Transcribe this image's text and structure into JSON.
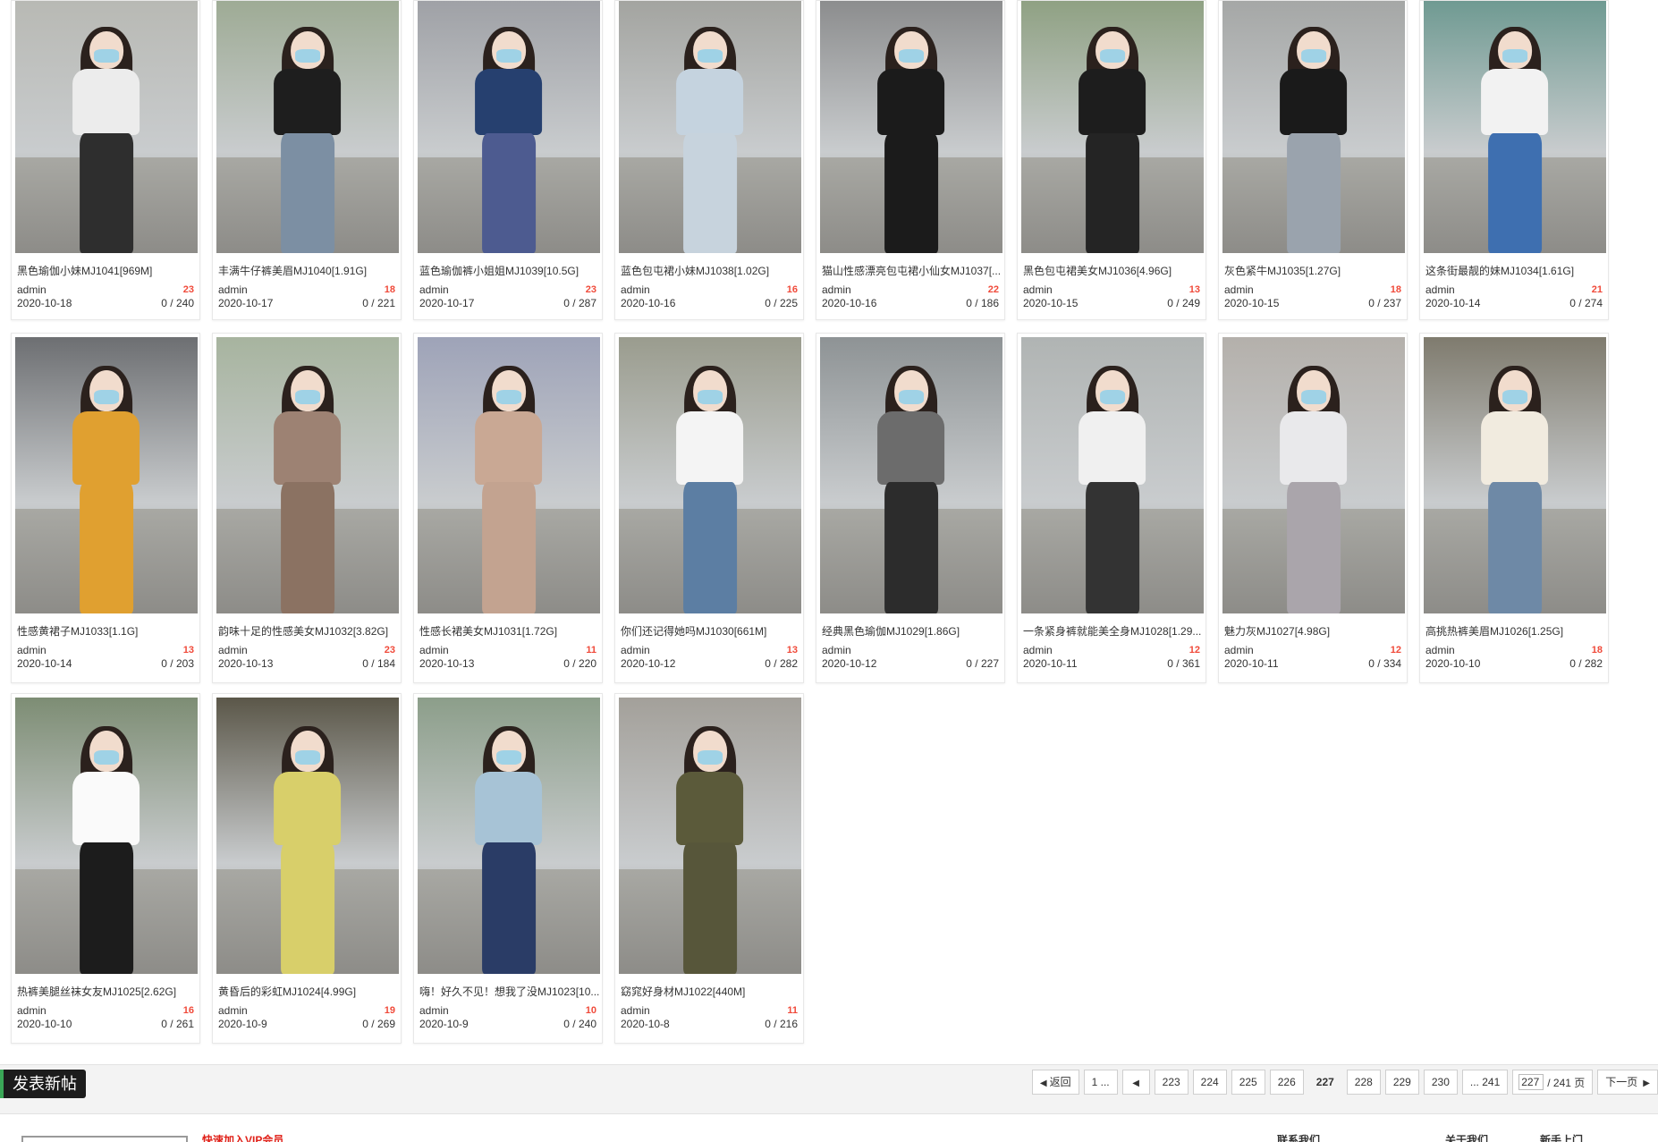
{
  "cards": [
    {
      "title": "黑色瑜伽小妹MJ1041[969M]",
      "author": "admin",
      "badge": "23",
      "date": "2020-10-18",
      "stats": "0 / 240",
      "top": "#ececec",
      "bottom": "#2e2e2e",
      "bg": "#b8b9b4"
    },
    {
      "title": "丰满牛仔裤美眉MJ1040[1.91G]",
      "author": "admin",
      "badge": "18",
      "date": "2020-10-17",
      "stats": "0 / 221",
      "top": "#1e1e1e",
      "bottom": "#7c8fa3",
      "bg": "#9eab95"
    },
    {
      "title": "蓝色瑜伽裤小姐姐MJ1039[10.5G]",
      "author": "admin",
      "badge": "23",
      "date": "2020-10-17",
      "stats": "0 / 287",
      "top": "#26406f",
      "bottom": "#4d5b90",
      "bg": "#9fa1a6"
    },
    {
      "title": "蓝色包屯裙小妹MJ1038[1.02G]",
      "author": "admin",
      "badge": "16",
      "date": "2020-10-16",
      "stats": "0 / 225",
      "top": "#c5d3df",
      "bottom": "#c7d3dd",
      "bg": "#a3a4a0"
    },
    {
      "title": "猫山性感漂亮包屯裙小仙女MJ1037[...",
      "author": "admin",
      "badge": "22",
      "date": "2020-10-16",
      "stats": "0 / 186",
      "top": "#1b1b1b",
      "bottom": "#1b1b1b",
      "bg": "#8c8d8e"
    },
    {
      "title": "黑色包屯裙美女MJ1036[4.96G]",
      "author": "admin",
      "badge": "13",
      "date": "2020-10-15",
      "stats": "0 / 249",
      "top": "#1d1d1d",
      "bottom": "#242424",
      "bg": "#8fa183"
    },
    {
      "title": "灰色紧牛MJ1035[1.27G]",
      "author": "admin",
      "badge": "18",
      "date": "2020-10-15",
      "stats": "0 / 237",
      "top": "#1a1a1a",
      "bottom": "#9aa3ad",
      "bg": "#a5a7a6"
    },
    {
      "title": "这条街最靓的妹MJ1034[1.61G]",
      "author": "admin",
      "badge": "21",
      "date": "2020-10-14",
      "stats": "0 / 274",
      "top": "#f2f2f2",
      "bottom": "#3e6fb0",
      "bg": "#6f9a92"
    },
    {
      "title": "性感黄裙子MJ1033[1.1G]",
      "author": "admin",
      "badge": "13",
      "date": "2020-10-14",
      "stats": "0 / 203",
      "top": "#e0a030",
      "bottom": "#e0a030",
      "bg": "#6d6f72"
    },
    {
      "title": "韵味十足的性感美女MJ1032[3.82G]",
      "author": "admin",
      "badge": "23",
      "date": "2020-10-13",
      "stats": "0 / 184",
      "top": "#9d8273",
      "bottom": "#8b7262",
      "bg": "#a7b49f"
    },
    {
      "title": "性感长裙美女MJ1031[1.72G]",
      "author": "admin",
      "badge": "11",
      "date": "2020-10-13",
      "stats": "0 / 220",
      "top": "#c9a894",
      "bottom": "#c3a390",
      "bg": "#9ea3b8"
    },
    {
      "title": "你们还记得她吗MJ1030[661M]",
      "author": "admin",
      "badge": "13",
      "date": "2020-10-12",
      "stats": "0 / 282",
      "top": "#f4f4f4",
      "bottom": "#5c7ea3",
      "bg": "#9a9c8e"
    },
    {
      "title": "经典黑色瑜伽MJ1029[1.86G]",
      "author": "admin",
      "badge": "",
      "date": "2020-10-12",
      "stats": "0 / 227",
      "top": "#6c6c6c",
      "bottom": "#2c2c2c",
      "bg": "#8e9395"
    },
    {
      "title": "一条紧身裤就能美全身MJ1028[1.29...",
      "author": "admin",
      "badge": "12",
      "date": "2020-10-11",
      "stats": "0 / 361",
      "top": "#f0f0f0",
      "bottom": "#333333",
      "bg": "#b0b4b3"
    },
    {
      "title": "魅力灰MJ1027[4.98G]",
      "author": "admin",
      "badge": "12",
      "date": "2020-10-11",
      "stats": "0 / 334",
      "top": "#e9e9eb",
      "bottom": "#aaa5ab",
      "bg": "#b4b0ab"
    },
    {
      "title": "高挑热裤美眉MJ1026[1.25G]",
      "author": "admin",
      "badge": "18",
      "date": "2020-10-10",
      "stats": "0 / 282",
      "top": "#f1ebdf",
      "bottom": "#6e89a6",
      "bg": "#7f7b6e"
    },
    {
      "title": "热裤美腿丝袜女友MJ1025[2.62G]",
      "author": "admin",
      "badge": "16",
      "date": "2020-10-10",
      "stats": "0 / 261",
      "top": "#fafafa",
      "bottom": "#1c1c1c",
      "bg": "#7d8d74"
    },
    {
      "title": "黄昏后的彩虹MJ1024[4.99G]",
      "author": "admin",
      "badge": "19",
      "date": "2020-10-9",
      "stats": "0 / 269",
      "top": "#d8cf6a",
      "bottom": "#d8cf6a",
      "bg": "#5b5749"
    },
    {
      "title": "嗨！好久不见！想我了没MJ1023[10...",
      "author": "admin",
      "badge": "10",
      "date": "2020-10-9",
      "stats": "0 / 240",
      "top": "#a7c3d6",
      "bottom": "#2a3c66",
      "bg": "#8c9e8a"
    },
    {
      "title": "窈窕好身材MJ1022[440M]",
      "author": "admin",
      "badge": "11",
      "date": "2020-10-8",
      "stats": "0 / 216",
      "top": "#5b5a3a",
      "bottom": "#57563a",
      "bg": "#a3a09a"
    }
  ],
  "post_button": "发表新帖",
  "pager": {
    "back": "返回",
    "first": "1 ...",
    "pages": [
      "223",
      "224",
      "225",
      "226",
      "227",
      "228",
      "229",
      "230"
    ],
    "current": "227",
    "last": "... 241",
    "input_value": "227",
    "total": "/ 241 页",
    "next": "下一页"
  },
  "footer": {
    "red_text": "快速加入VIP会员",
    "links": [
      "联系我们",
      "关于我们",
      "新手上门"
    ]
  },
  "colors": {
    "badge": "#f04a3a",
    "post_button_bg": "#1c1c1c",
    "pager_border": "#cfcfcf"
  }
}
